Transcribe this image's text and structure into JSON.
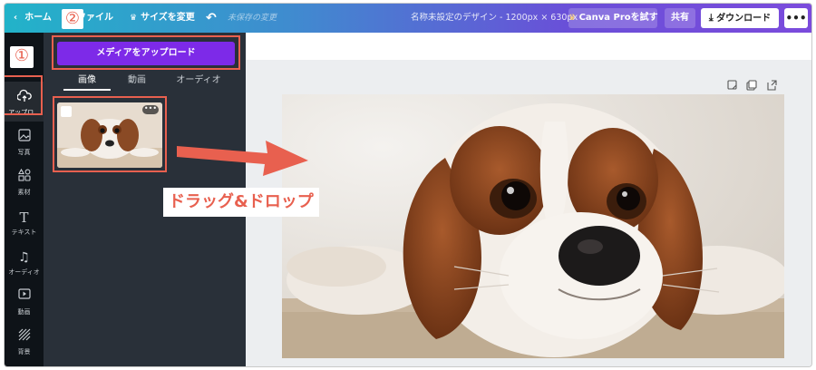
{
  "topbar": {
    "back_label": "ホーム",
    "file_label": "ファイル",
    "resize_label": "サイズを変更",
    "unsaved_label": "未保存の変更",
    "design_title": "名称未設定のデザイン - 1200px × 630px",
    "pro_label": "Canva Proを試す",
    "share_label": "共有",
    "download_label": "ダウンロード",
    "more_label": "•••"
  },
  "nav": {
    "items": [
      {
        "label": "アップロ...",
        "icon": "upload-cloud-icon"
      },
      {
        "label": "写真",
        "icon": "photo-icon"
      },
      {
        "label": "素材",
        "icon": "elements-icon"
      },
      {
        "label": "テキスト",
        "icon": "text-icon"
      },
      {
        "label": "オーディオ",
        "icon": "music-note-icon"
      },
      {
        "label": "動画",
        "icon": "video-icon"
      },
      {
        "label": "背景",
        "icon": "background-icon"
      }
    ]
  },
  "panel": {
    "upload_button": "メディアをアップロード",
    "tabs": [
      "画像",
      "動画",
      "オーディオ"
    ],
    "active_tab": 0,
    "thumb_more": "•••"
  },
  "annotations": {
    "step1": "①",
    "step2": "②",
    "drag_drop": "ドラッグ&ドロップ",
    "color": "#e8604f"
  },
  "colors": {
    "accent": "#7d2ae8",
    "panel_bg": "#293039",
    "nav_bg": "#0e1318"
  }
}
